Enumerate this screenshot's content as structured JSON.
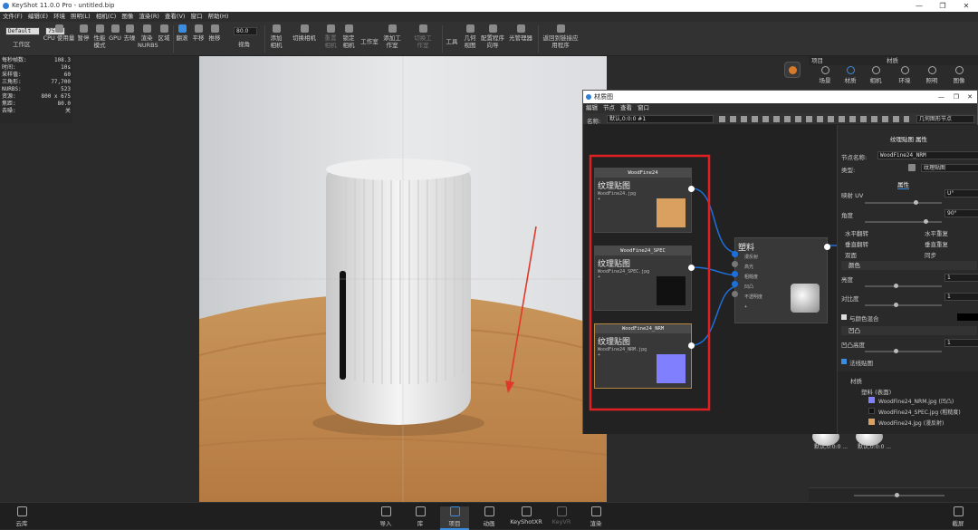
{
  "app": {
    "title": "KeyShot 11.0.0 Pro  - untitled.bip"
  },
  "window_controls": [
    "—",
    "❐",
    "✕"
  ],
  "menu": [
    "文件(F)",
    "编辑(E)",
    "环境",
    "照明(L)",
    "相机(C)",
    "图像",
    "渲染(R)",
    "查看(V)",
    "窗口",
    "帮助(H)"
  ],
  "toolbar": {
    "preset_value": "Default",
    "zoom_value": "75 %",
    "fov_value": "80.0",
    "workspace_label": "工作区",
    "items": [
      "CPU 使用量",
      "暂停",
      "性能模式",
      "GPU",
      "去噪",
      "渲染NURBS",
      "区域",
      "翻滚",
      "平移",
      "推移",
      "视角",
      "添加相机",
      "切换相机",
      "重置相机",
      "锁定相机",
      "工作室",
      "添加工作室",
      "切换工作室",
      "工具",
      "几何视图",
      "配置程序向导",
      "光管理器",
      "返回到链接应用程序"
    ]
  },
  "stats": [
    [
      "每秒帧数:",
      "108.3"
    ],
    [
      "时间:",
      "10s"
    ],
    [
      "采样值:",
      "60"
    ],
    [
      "三角形:",
      "77,700"
    ],
    [
      "NURBS:",
      "523"
    ],
    [
      "资源:",
      "800 x 675"
    ],
    [
      "焦距:",
      "80.0"
    ],
    [
      "去噪:",
      "关"
    ]
  ],
  "right_panel": {
    "left_tab": "项目",
    "header": "材质",
    "tabs": [
      "场景",
      "材质",
      "相机",
      "环境",
      "照明",
      "图像"
    ],
    "thumb_labels": [
      "默认,0:0:0 ...",
      "默认,0:0:0 ..."
    ]
  },
  "material_graph": {
    "title": "材质图",
    "menu": [
      "編辑",
      "节点",
      "查看",
      "窗口"
    ],
    "name_label": "名称:",
    "name_value": "默认,0:0:0 #1",
    "geometry_button": "几何图形节点",
    "nodes": [
      {
        "header": "WoodFine24",
        "title": "纹理贴图",
        "file": "WoodFine24.jpg",
        "swatch": "#d9a060"
      },
      {
        "header": "WoodFine24_SPEC",
        "title": "纹理贴图",
        "file": "WoodFine24_SPEC.jpg",
        "swatch": "#1a1a1a"
      },
      {
        "header": "WoodFine24_NRM",
        "title": "纹理贴图",
        "file": "WoodFine24_NRM.jpg",
        "swatch": "#8080ff"
      }
    ],
    "plastic": {
      "title": "塑料",
      "inputs": [
        "漫反射",
        "高光",
        "粗糙度",
        "凹凸",
        "不透明度"
      ]
    }
  },
  "properties": {
    "header": "纹理贴图 属性",
    "node_name_label": "节点名称:",
    "node_name_value": "WoodFine24_NRM",
    "type_label": "类型:",
    "type_value": "纹理贴图",
    "attr_tab": "属性",
    "mapping_label": "映射 UV",
    "mapping_value": "U°",
    "angle_label": "角度",
    "angle_value": "90°",
    "flip_h": "水平翻转",
    "repeat_h": "水平重复",
    "flip_v": "垂直翻转",
    "repeat_v": "垂直重复",
    "double_sided": "双面",
    "sync": "同步",
    "color_section": "颜色",
    "brightness_label": "亮度",
    "brightness_value": "1",
    "contrast_label": "对比度",
    "contrast_value": "1",
    "blend_label": "与颜色混合",
    "bump_section": "凹凸",
    "bump_height_label": "凹凸高度",
    "bump_height_value": "1",
    "normal_map_label": "法线贴图",
    "tree": [
      {
        "label": "材质",
        "swatch": ""
      },
      {
        "label": "塑料 (表面)",
        "swatch": ""
      },
      {
        "label": "WoodFine24_NRM.jpg (凹凸)",
        "swatch": "#8080ff"
      },
      {
        "label": "WoodFine24_SPEC.jpg (粗糙度)",
        "swatch": "#111111"
      },
      {
        "label": "WoodFine24.jpg (漫反射)",
        "swatch": "#d9a060"
      }
    ]
  },
  "bottom_bar": {
    "left": "云库",
    "items": [
      "导入",
      "库",
      "项目",
      "动画",
      "KeyShotXR",
      "KeyVR",
      "渲染"
    ],
    "right": "截屏"
  },
  "colors": {
    "accent": "#3b8de0",
    "highlight_box": "#e02020",
    "annotation_arrow": "#e0392b"
  }
}
